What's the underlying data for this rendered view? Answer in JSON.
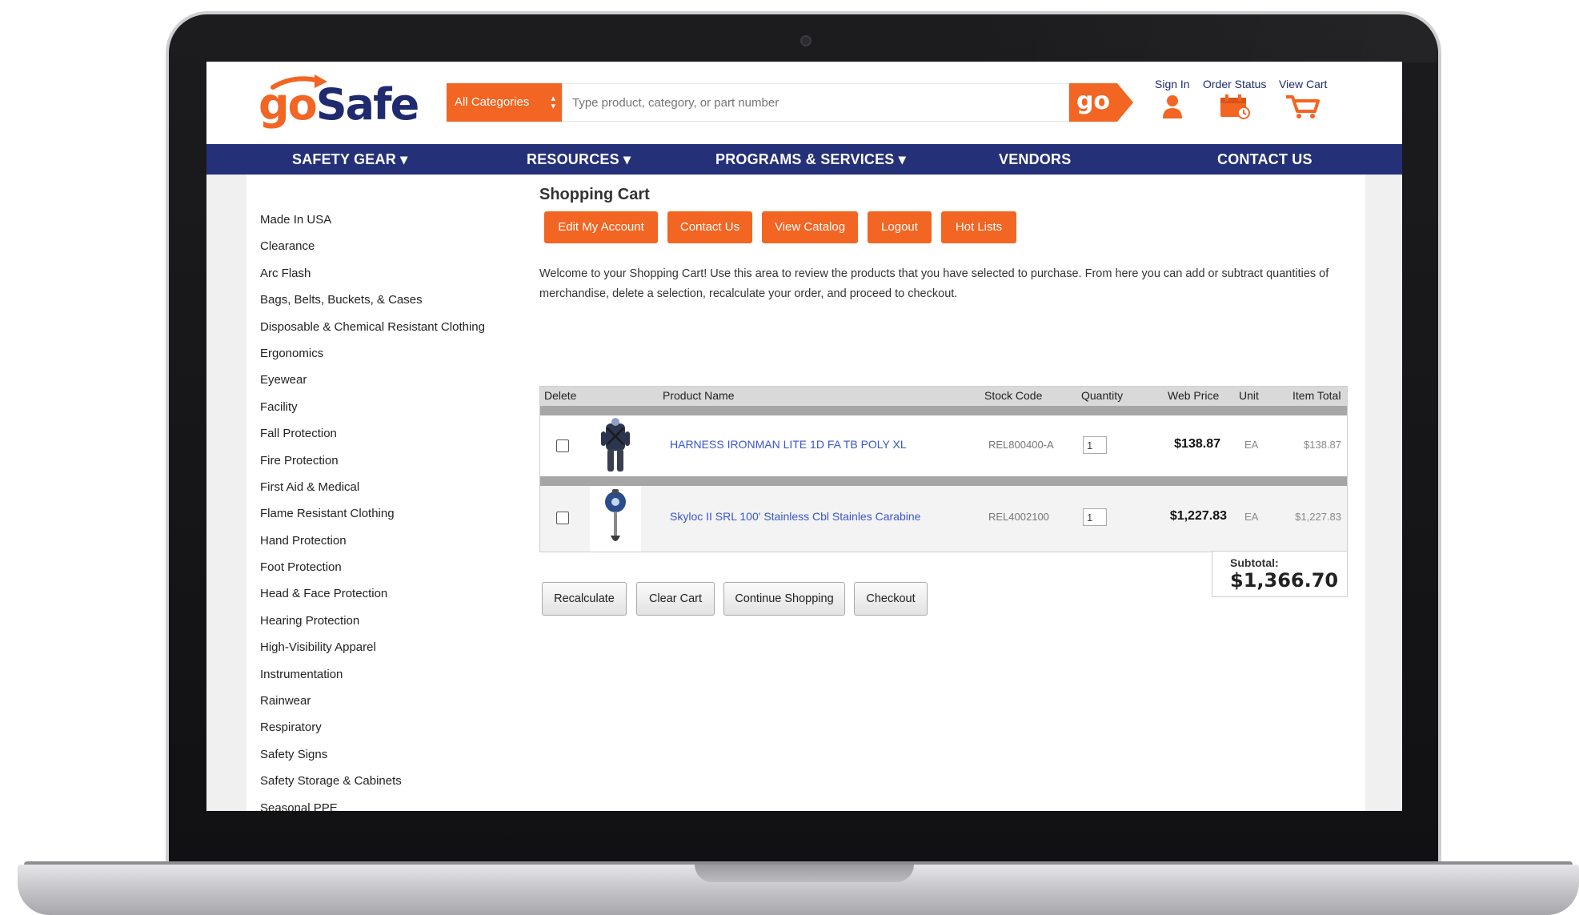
{
  "brand": {
    "logo_go": "go",
    "logo_safe": "Safe",
    "primary_color": "#f26522",
    "nav_color": "#243078"
  },
  "search": {
    "category_label": "All Categories",
    "placeholder": "Type product, category, or part number",
    "go_label": "go"
  },
  "header_links": {
    "sign_in": "Sign In",
    "order_status": "Order Status",
    "view_cart": "View Cart"
  },
  "nav": {
    "items": [
      "SAFETY GEAR ▾",
      "RESOURCES ▾",
      "PROGRAMS & SERVICES ▾",
      "VENDORS",
      "CONTACT US"
    ]
  },
  "sidebar": {
    "items": [
      "Made In USA",
      "Clearance",
      "Arc Flash",
      "Bags, Belts, Buckets, & Cases",
      "Disposable & Chemical Resistant Clothing",
      "Ergonomics",
      "Eyewear",
      "Facility",
      "Fall Protection",
      "Fire Protection",
      "First Aid & Medical",
      "Flame Resistant Clothing",
      "Hand Protection",
      "Foot Protection",
      "Head & Face Protection",
      "Hearing Protection",
      "High-Visibility Apparel",
      "Instrumentation",
      "Rainwear",
      "Respiratory",
      "Safety Signs",
      "Safety Storage & Cabinets",
      "Seasonal PPE"
    ]
  },
  "main": {
    "title": "Shopping Cart",
    "action_buttons": [
      "Edit My Account",
      "Contact Us",
      "View Catalog",
      "Logout",
      "Hot Lists"
    ],
    "welcome_text": "Welcome to your Shopping Cart! Use this area to review the products that you have selected to purchase. From here you can add or subtract quantities of merchandise, delete a selection, recalculate your order, and proceed to checkout."
  },
  "cart": {
    "columns": [
      "Delete",
      "Product Name",
      "Stock Code",
      "Quantity",
      "Web Price",
      "Unit",
      "Item Total"
    ],
    "rows": [
      {
        "product_name": "HARNESS IRONMAN LITE 1D FA TB POLY XL",
        "stock_code": "REL800400-A",
        "quantity": "1",
        "web_price": "$138.87",
        "unit": "EA",
        "item_total": "$138.87",
        "thumb_icon": "harness-icon"
      },
      {
        "product_name": "Skyloc II SRL 100' Stainless Cbl Stainles Carabine",
        "stock_code": "REL4002100",
        "quantity": "1",
        "web_price": "$1,227.83",
        "unit": "EA",
        "item_total": "$1,227.83",
        "thumb_icon": "srl-lifeline-icon"
      }
    ],
    "subtotal_label": "Subtotal:",
    "subtotal_value": "$1,366.70"
  },
  "cart_actions": [
    "Recalculate",
    "Clear Cart",
    "Continue Shopping",
    "Checkout"
  ]
}
